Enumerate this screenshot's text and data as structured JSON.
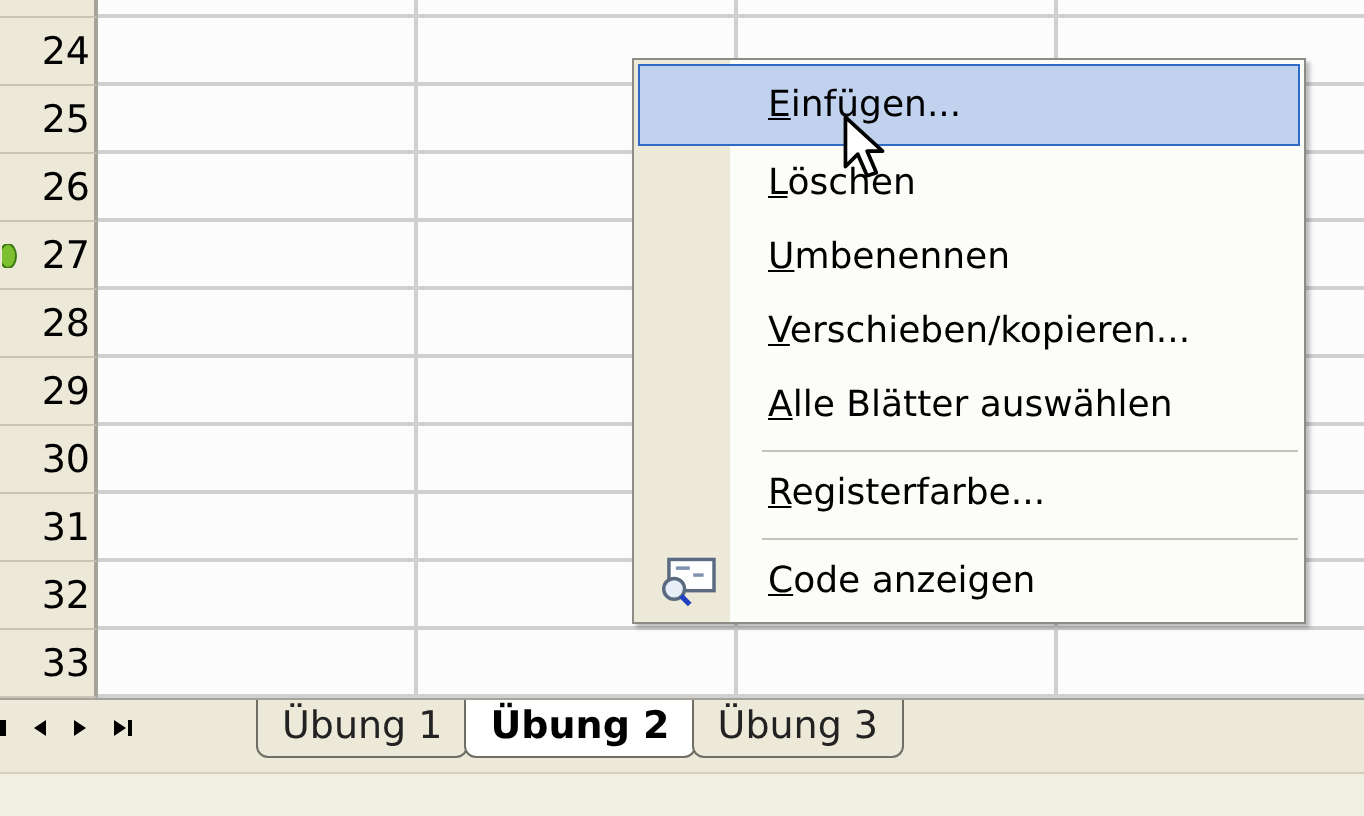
{
  "sheet": {
    "rows": [
      {
        "number": "24",
        "marker": false
      },
      {
        "number": "25",
        "marker": false
      },
      {
        "number": "26",
        "marker": false
      },
      {
        "number": "27",
        "marker": true
      },
      {
        "number": "28",
        "marker": false
      },
      {
        "number": "29",
        "marker": false
      },
      {
        "number": "30",
        "marker": false
      },
      {
        "number": "31",
        "marker": false
      },
      {
        "number": "32",
        "marker": false
      },
      {
        "number": "33",
        "marker": false
      }
    ]
  },
  "tab_nav": [
    {
      "kind": "first"
    },
    {
      "kind": "prev"
    },
    {
      "kind": "next"
    },
    {
      "kind": "last"
    }
  ],
  "tabs": [
    {
      "label": "Übung 1",
      "selected": false
    },
    {
      "label": "Übung 2",
      "selected": true
    },
    {
      "label": "Übung 3",
      "selected": false
    }
  ],
  "context_menu": {
    "items": [
      {
        "label": "Einfügen...",
        "selected": true,
        "separator_before": false,
        "icon": false
      },
      {
        "label": "Löschen",
        "selected": false,
        "separator_before": false,
        "icon": false
      },
      {
        "label": "Umbenennen",
        "selected": false,
        "separator_before": false,
        "icon": false
      },
      {
        "label": "Verschieben/kopieren...",
        "selected": false,
        "separator_before": false,
        "icon": false
      },
      {
        "label": "Alle Blätter auswählen",
        "selected": false,
        "separator_before": false,
        "icon": false
      },
      {
        "label": "Registerfarbe...",
        "selected": false,
        "separator_before": true,
        "icon": false
      },
      {
        "label": "Code anzeigen",
        "selected": false,
        "separator_before": true,
        "icon": true
      }
    ]
  }
}
